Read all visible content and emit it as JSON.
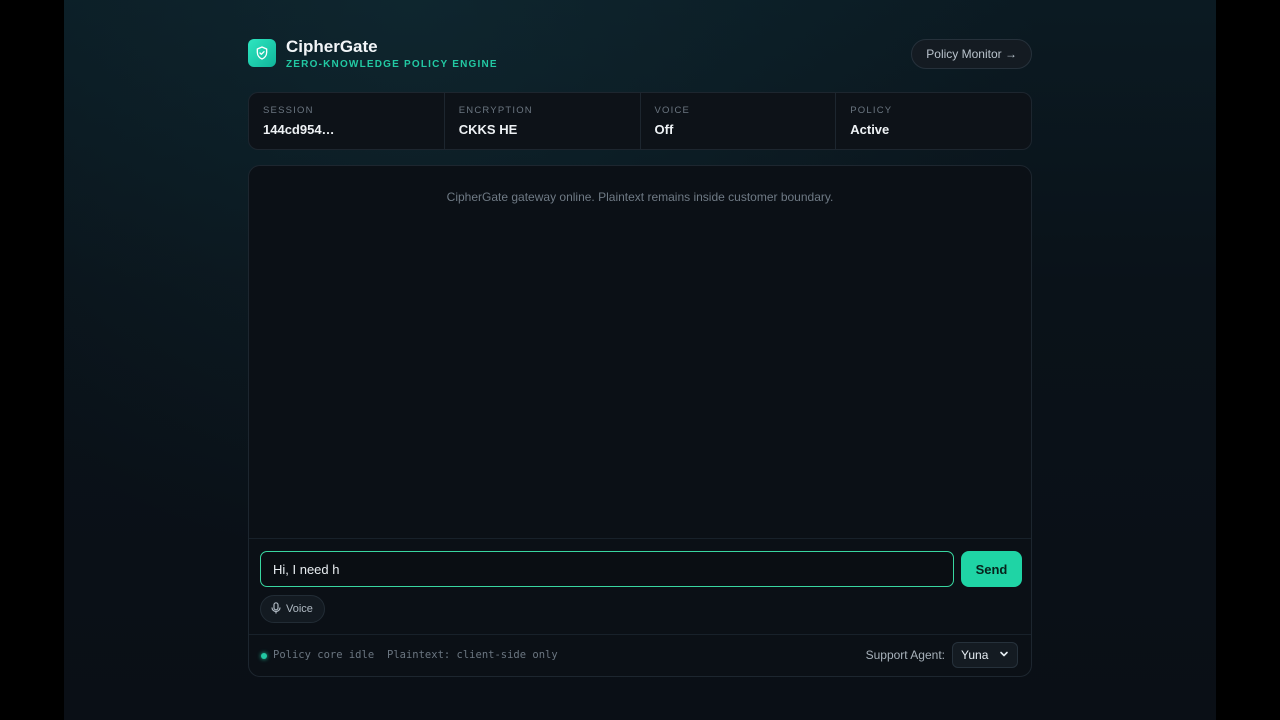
{
  "app": {
    "name": "CipherGate",
    "tagline": "ZERO-KNOWLEDGE POLICY ENGINE",
    "monitor_label": "Policy Monitor →",
    "accent_color": "#1fd4a5"
  },
  "stats": [
    {
      "label": "SESSION",
      "value": "144cd954…"
    },
    {
      "label": "ENCRYPTION",
      "value": "CKKS HE"
    },
    {
      "label": "VOICE",
      "value": "Off"
    },
    {
      "label": "POLICY",
      "value": "Active"
    }
  ],
  "chat": {
    "system_message": "CipherGate gateway online. Plaintext remains inside customer boundary.",
    "input_value": "Hi, I need h",
    "send_label": "Send",
    "voice_label": "Voice"
  },
  "footer": {
    "status": "Policy core idle",
    "plaintext_note": "Plaintext: client-side only",
    "agent_label": "Support Agent:",
    "agent_selected": "Yuna"
  },
  "icons": {
    "logo": "shield-icon",
    "voice": "microphone-icon",
    "select": "chevron-down-icon"
  }
}
